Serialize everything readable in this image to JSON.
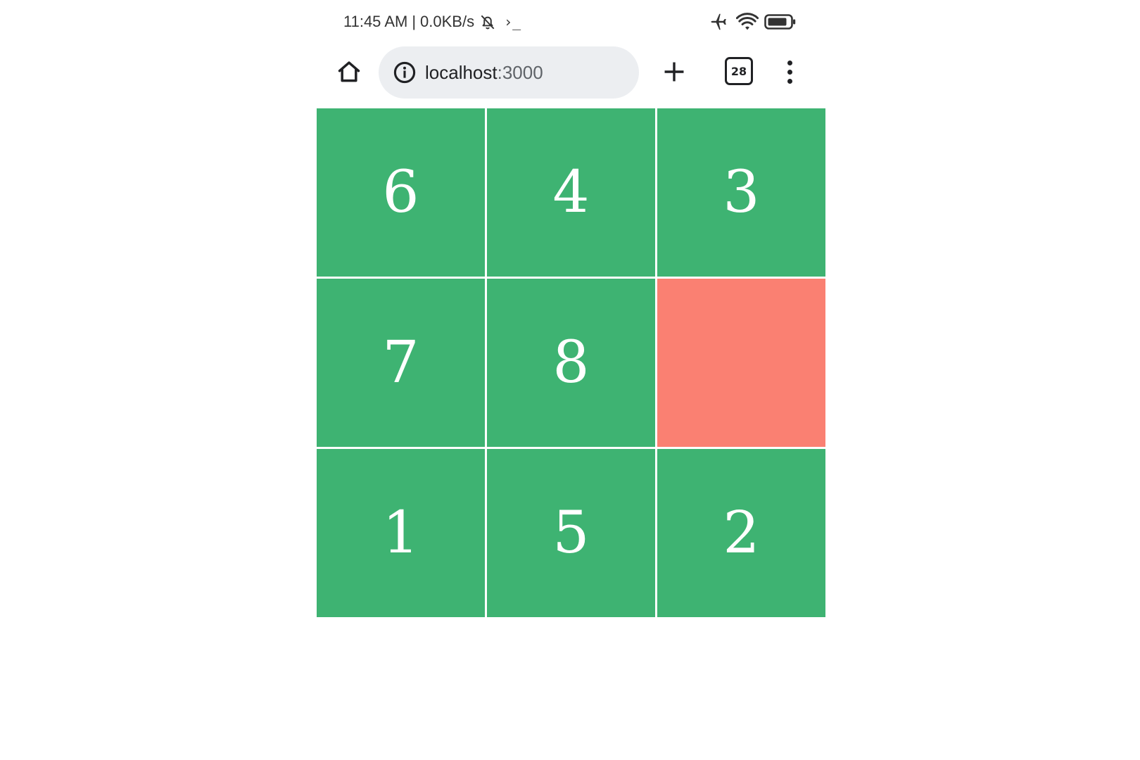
{
  "status_bar": {
    "time": "11:45 AM",
    "separator": "|",
    "net_speed": "0.0KB/s",
    "terminal_glyph": "›_",
    "icons": [
      "bell-off-icon",
      "terminal-icon",
      "airplane-icon",
      "wifi-icon",
      "battery-icon"
    ]
  },
  "toolbar": {
    "url_host": "localhost",
    "url_port": ":3000",
    "tab_count": "28",
    "icons": [
      "home-icon",
      "info-icon",
      "plus-icon",
      "more-vertical-icon"
    ]
  },
  "puzzle": {
    "tiles": [
      "6",
      "4",
      "3",
      "7",
      "8",
      "",
      "1",
      "5",
      "2"
    ],
    "empty_index": 5,
    "tile_color": "#3eb372",
    "empty_color": "#fa8072",
    "text_color": "#ffffff"
  }
}
